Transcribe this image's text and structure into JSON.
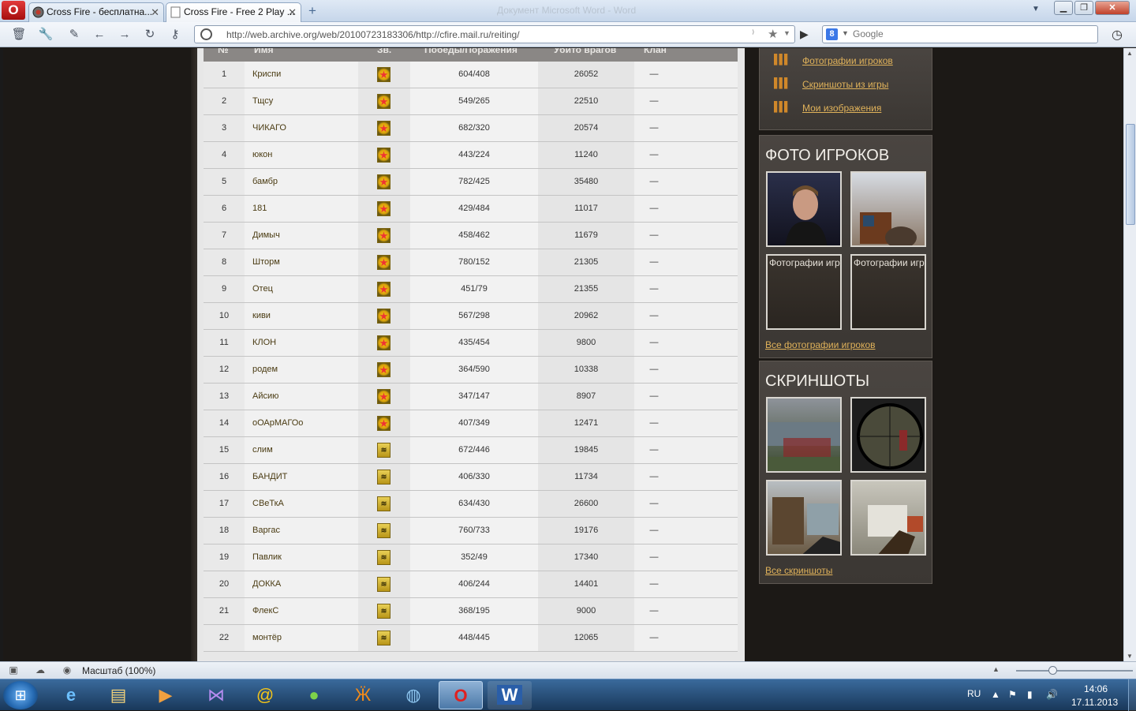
{
  "browser": {
    "window_title": "Документ Microsoft Word - Word",
    "tabs": [
      {
        "label": "Cross Fire - бесплатна...",
        "active": false
      },
      {
        "label": "Cross Fire - Free 2 Play ...",
        "active": true
      }
    ],
    "url": "http://web.archive.org/web/20100723183306/http://cfire.mail.ru/reiting/",
    "search_placeholder": "Google",
    "search_engine_icon": "8"
  },
  "table": {
    "headers": {
      "num": "№",
      "name": "Имя",
      "rank": "Зв.",
      "wins": "Победы/Поражения",
      "kills": "Убито врагов",
      "clan": "Клан"
    },
    "rows": [
      {
        "num": "1",
        "name": "Криспи",
        "rank": "star",
        "wins": "604/408",
        "kills": "26052",
        "clan": "—"
      },
      {
        "num": "2",
        "name": "Тщсу",
        "rank": "star",
        "wins": "549/265",
        "kills": "22510",
        "clan": "—"
      },
      {
        "num": "3",
        "name": "ЧИКАГО",
        "rank": "star",
        "wins": "682/320",
        "kills": "20574",
        "clan": "—"
      },
      {
        "num": "4",
        "name": "юкон",
        "rank": "star",
        "wins": "443/224",
        "kills": "11240",
        "clan": "—"
      },
      {
        "num": "5",
        "name": "бамбр",
        "rank": "star",
        "wins": "782/425",
        "kills": "35480",
        "clan": "—"
      },
      {
        "num": "6",
        "name": "181",
        "rank": "star",
        "wins": "429/484",
        "kills": "11017",
        "clan": "—"
      },
      {
        "num": "7",
        "name": "Димыч",
        "rank": "star",
        "wins": "458/462",
        "kills": "11679",
        "clan": "—"
      },
      {
        "num": "8",
        "name": "Шторм",
        "rank": "star",
        "wins": "780/152",
        "kills": "21305",
        "clan": "—"
      },
      {
        "num": "9",
        "name": "Отец",
        "rank": "star",
        "wins": "451/79",
        "kills": "21355",
        "clan": "—"
      },
      {
        "num": "10",
        "name": "киви",
        "rank": "star",
        "wins": "567/298",
        "kills": "20962",
        "clan": "—"
      },
      {
        "num": "11",
        "name": "КЛОН",
        "rank": "star",
        "wins": "435/454",
        "kills": "9800",
        "clan": "—"
      },
      {
        "num": "12",
        "name": "родем",
        "rank": "star",
        "wins": "364/590",
        "kills": "10338",
        "clan": "—"
      },
      {
        "num": "13",
        "name": "Айсию",
        "rank": "star",
        "wins": "347/147",
        "kills": "8907",
        "clan": "—"
      },
      {
        "num": "14",
        "name": "оОАрМАГОо",
        "rank": "star",
        "wins": "407/349",
        "kills": "12471",
        "clan": "—"
      },
      {
        "num": "15",
        "name": "слим",
        "rank": "chevron",
        "wins": "672/446",
        "kills": "19845",
        "clan": "—"
      },
      {
        "num": "16",
        "name": "БАНДИТ",
        "rank": "chevron",
        "wins": "406/330",
        "kills": "11734",
        "clan": "—"
      },
      {
        "num": "17",
        "name": "СВеТкА",
        "rank": "chevron",
        "wins": "634/430",
        "kills": "26600",
        "clan": "—"
      },
      {
        "num": "18",
        "name": "Варгас",
        "rank": "chevron",
        "wins": "760/733",
        "kills": "19176",
        "clan": "—"
      },
      {
        "num": "19",
        "name": "Павлик",
        "rank": "chevron",
        "wins": "352/49",
        "kills": "17340",
        "clan": "—"
      },
      {
        "num": "20",
        "name": "ДОККА",
        "rank": "chevron",
        "wins": "406/244",
        "kills": "14401",
        "clan": "—"
      },
      {
        "num": "21",
        "name": "ФлекС",
        "rank": "chevron",
        "wins": "368/195",
        "kills": "9000",
        "clan": "—"
      },
      {
        "num": "22",
        "name": "монтёр",
        "rank": "chevron",
        "wins": "448/445",
        "kills": "12065",
        "clan": "—"
      }
    ]
  },
  "sidebar": {
    "links": [
      "Фотографии игроков",
      "Скриншоты из игры",
      "Мои изображения"
    ],
    "photos": {
      "title": "ФОТО ИГРОКОВ",
      "captions": [
        "Фотографии игр",
        "Фотографии игр"
      ],
      "all_link": "Все фотографии игроков"
    },
    "screens": {
      "title": "СКРИНШОТЫ",
      "all_link": "Все скриншоты"
    }
  },
  "status": {
    "zoom_label": "Масштаб (100%)",
    "zoom_fraction": 0.3
  },
  "taskbar": {
    "lang": "RU",
    "time": "14:06",
    "date": "17.11.2013"
  }
}
